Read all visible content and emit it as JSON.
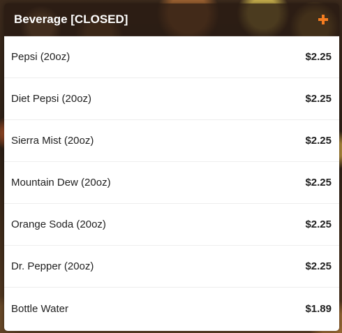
{
  "section": {
    "title": "Beverage [CLOSED]",
    "add_icon": "plus-icon",
    "accent_color": "#f47c20"
  },
  "items": [
    {
      "name": "Pepsi (20oz)",
      "price": "$2.25"
    },
    {
      "name": "Diet Pepsi (20oz)",
      "price": "$2.25"
    },
    {
      "name": "Sierra Mist (20oz)",
      "price": "$2.25"
    },
    {
      "name": "Mountain Dew (20oz)",
      "price": "$2.25"
    },
    {
      "name": "Orange Soda (20oz)",
      "price": "$2.25"
    },
    {
      "name": "Dr. Pepper (20oz)",
      "price": "$2.25"
    },
    {
      "name": "Bottle Water",
      "price": "$1.89"
    }
  ]
}
